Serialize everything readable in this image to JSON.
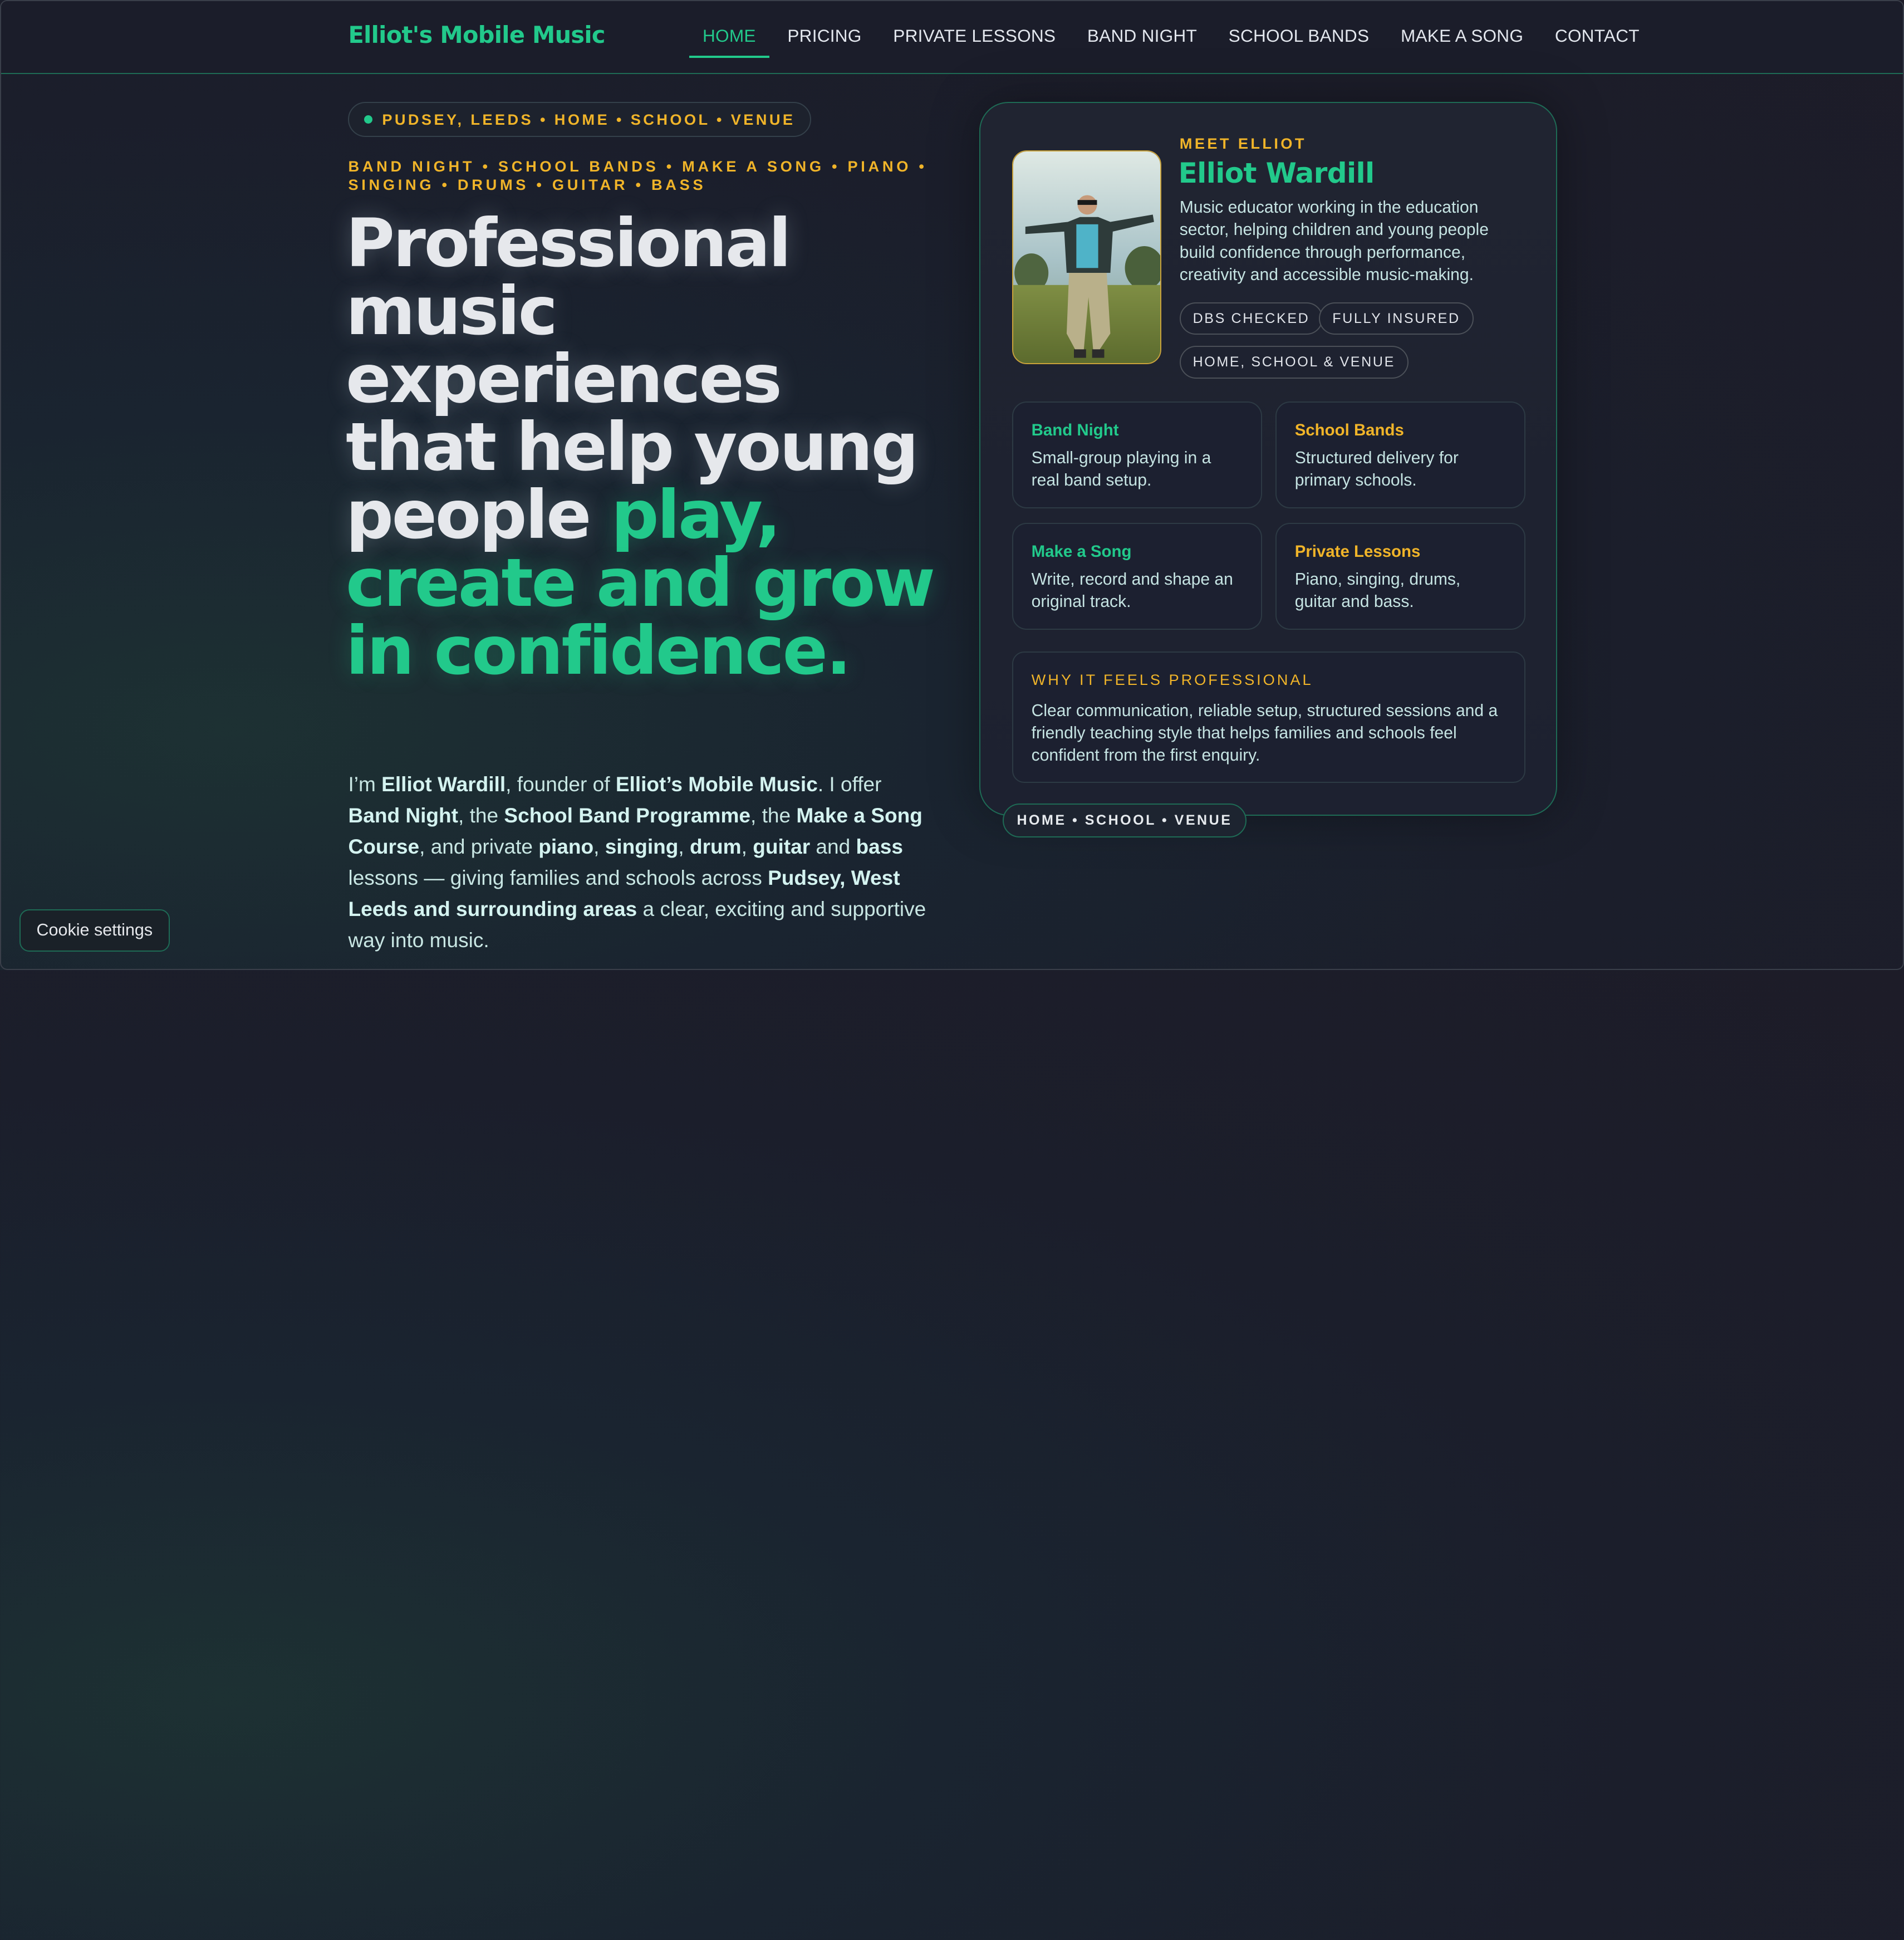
{
  "brand": "Elliot's Mobile Music",
  "nav": [
    "HOME",
    "PRICING",
    "PRIVATE LESSONS",
    "BAND NIGHT",
    "SCHOOL BANDS",
    "MAKE A SONG",
    "CONTACT"
  ],
  "hero": {
    "location_pill": "PUDSEY, LEEDS • HOME • SCHOOL • VENUE",
    "services_line": "BAND NIGHT • SCHOOL BANDS • MAKE A SONG • PIANO • SINGING • DRUMS • GUITAR • BASS",
    "headline_plain": "Professional music experiences that help young people ",
    "headline_accent": "play, create and grow in confidence.",
    "intro": {
      "p1": "I’m ",
      "name": "Elliot Wardill",
      "p2": ", founder of ",
      "company": "Elliot’s Mobile Music",
      "p3": ". I offer ",
      "s1": "Band Night",
      "p4": ", the ",
      "s2": "School Band Programme",
      "p5": ", the ",
      "s3": "Make a Song Course",
      "p6": ", and private ",
      "i1": "piano",
      "c1": ", ",
      "i2": "singing",
      "c2": ", ",
      "i3": "drum",
      "c3": ", ",
      "i4": "guitar",
      "p7": " and ",
      "i5": "bass",
      "p8": " lessons — giving families and schools across ",
      "area": "Pudsey, West Leeds and surrounding areas",
      "p9": " a clear, exciting and supportive way into music."
    }
  },
  "meet": {
    "kicker": "MEET ELLIOT",
    "name": "Elliot Wardill",
    "bio": "Music educator working in the education sector, helping children and young people build confidence through performance, creativity and accessible music-making.",
    "badges": [
      "DBS CHECKED",
      "FULLY INSURED",
      "HOME, SCHOOL & VENUE"
    ]
  },
  "services": [
    {
      "title": "Band Night",
      "desc": "Small-group playing in a real band setup."
    },
    {
      "title": "School Bands",
      "desc": "Structured delivery for primary schools."
    },
    {
      "title": "Make a Song",
      "desc": "Write, record and shape an original track."
    },
    {
      "title": "Private Lessons",
      "desc": "Piano, singing, drums, guitar and bass."
    }
  ],
  "why": {
    "kicker": "WHY IT FEELS PROFESSIONAL",
    "text": "Clear communication, reliable setup, structured sessions and a friendly teaching style that helps families and schools feel confident from the first enquiry."
  },
  "float_pill": "HOME • SCHOOL • VENUE",
  "cookie_button": "Cookie settings",
  "colors": {
    "accent": "#22c98b",
    "gold": "#f0b429",
    "background": "#1b1e2b"
  }
}
